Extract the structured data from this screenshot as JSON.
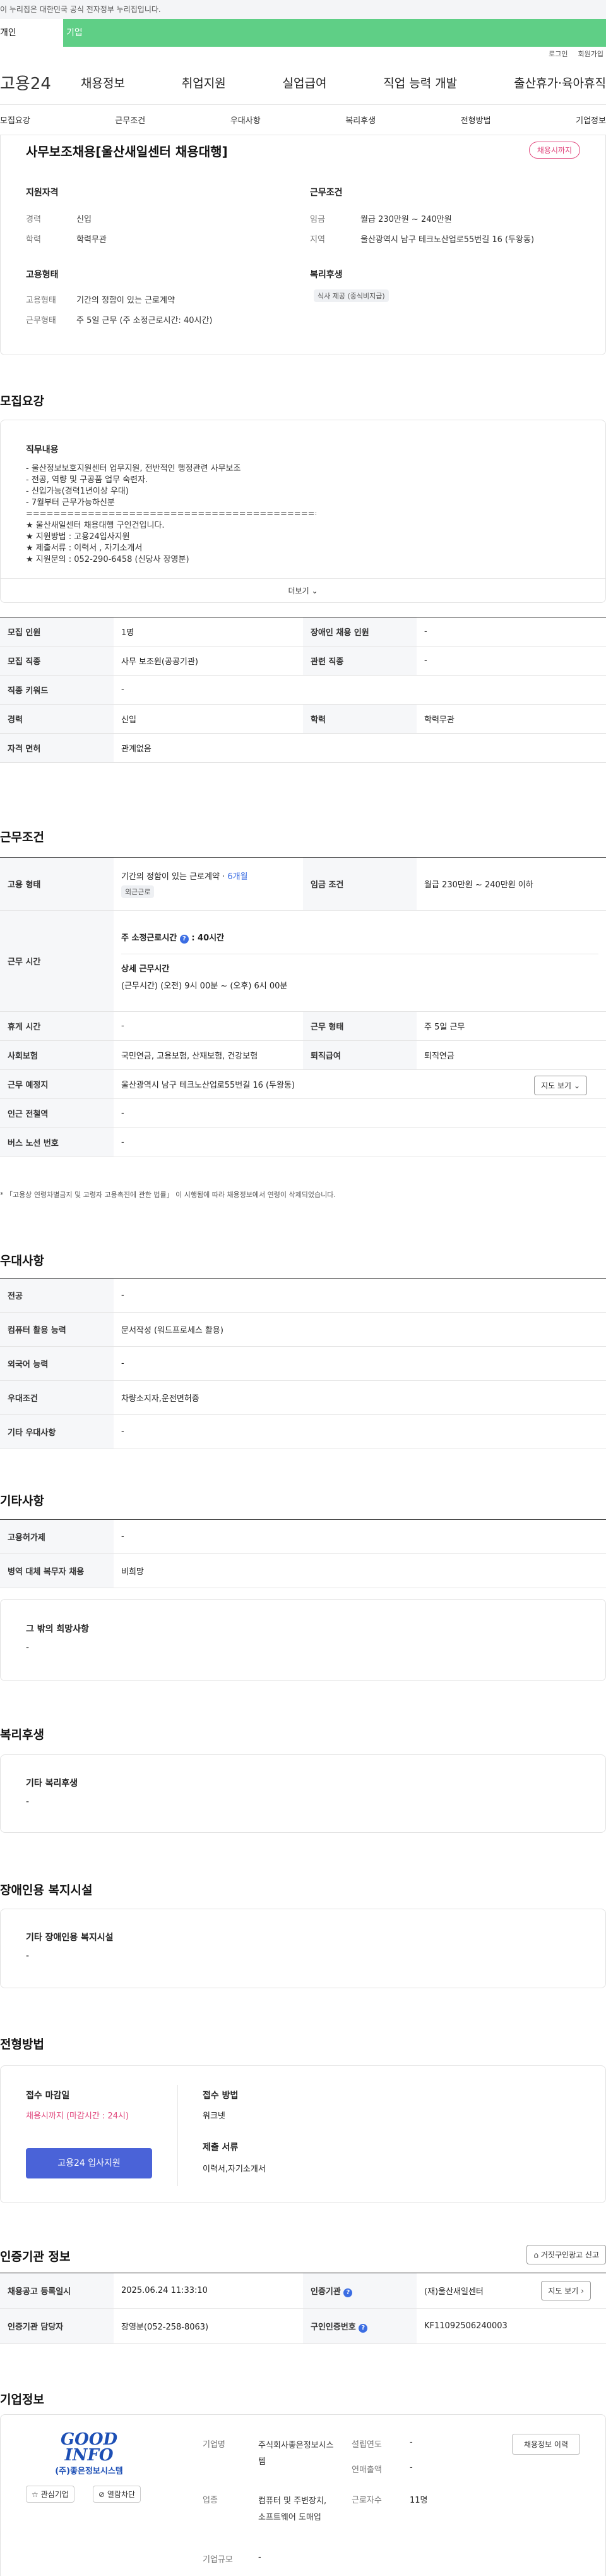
{
  "gov_banner": "이 누리집은 대한민국 공식 전자정부 누리집입니다.",
  "topbar": {
    "left": "개인",
    "right": "기업"
  },
  "util": {
    "login": "로그인",
    "join": "회원가입"
  },
  "logo": "고용24",
  "gnb": [
    "채용정보",
    "취업지원",
    "실업급여",
    "직업 능력 개발",
    "출산휴가·육아휴직"
  ],
  "subnav": [
    "모집요강",
    "근무조건",
    "우대사항",
    "복리후생",
    "전형방법",
    "기업정보"
  ],
  "summary": {
    "title": "사무보조채용[울산새일센터 채용대행]",
    "status_badge": "채용시까지",
    "qualification_title": "지원자격",
    "career_label": "경력",
    "career_value": "신입",
    "edu_label": "학력",
    "edu_value": "학력무관",
    "employ_title": "고용형태",
    "employ_type_label": "고용형태",
    "employ_type_value": "기간의 정함이 있는 근로계약",
    "work_type_label": "근무형태",
    "work_type_value": "주 5일 근무 (주 소정근로시간: 40시간)",
    "condition_title": "근무조건",
    "wage_label": "임금",
    "wage_value": "월급 230만원 ~ 240만원",
    "region_label": "지역",
    "region_value": "울산광역시 남구 테크노산업로55번길 16 (두왕동)",
    "welfare_title": "복리후생",
    "welfare_tag": "식사 제공 (중식비지급)"
  },
  "recruit": {
    "heading": "모집요강",
    "duty_title": "직무내용",
    "duty_lines": [
      "- 울산정보보호지원센터  업무지원, 전반적인 행정관련 사무보조",
      "- 전공, 역량 및 구공품 업무 숙련자.",
      "- 신입가능(경력1년이상 우대)",
      "- 7월부터 근무가능하신분",
      "============================================",
      "★ 울산새일센터 채용대행 구인건입니다.",
      "★ 지원방법 : 고용24입사지원",
      "★ 제출서류 : 이력서 , 자기소개서",
      "★ 지원문의 : 052-290-6458 (신당사 장영분)"
    ],
    "more_label": "더보기",
    "rows": [
      [
        {
          "k": "모집 인원",
          "v": "1명"
        },
        {
          "k": "장애인 채용 인원",
          "v": "-"
        }
      ],
      [
        {
          "k": "모집 직종",
          "v": "사무 보조원(공공기관)"
        },
        {
          "k": "관련 직종",
          "v": "-"
        }
      ],
      [
        {
          "k": "직종 키워드",
          "v": "-"
        }
      ],
      [
        {
          "k": "경력",
          "v": "신입"
        },
        {
          "k": "학력",
          "v": "학력무관"
        }
      ],
      [
        {
          "k": "자격 면허",
          "v": "관계없음"
        }
      ]
    ]
  },
  "work": {
    "heading": "근무조건",
    "employ_type_k": "고용 형태",
    "employ_type_v": "기간의 정함이 있는 근로계약 · ",
    "employ_period": "6개월",
    "employ_badge": "외근근로",
    "wage_k": "임금 조건",
    "wage_v": "월급 230만원 ~ 240만원 이하",
    "hours_k": "근무 시간",
    "hours_main": "주 소정근로시간",
    "hours_value": ": 40시간",
    "hours_detail_title": "상세 근무시간",
    "hours_detail": "(근무시간) (오전) 9시 00분 ~ (오후) 6시 00분",
    "rest_k": "휴게 시간",
    "rest_v": "-",
    "worktype_k": "근무 형태",
    "worktype_v": "주 5일 근무",
    "insurance_k": "사회보험",
    "insurance_v": "국민연금, 고용보험, 산재보험, 건강보험",
    "retire_k": "퇴직급여",
    "retire_v": "퇴직연금",
    "place_k": "근무 예정지",
    "place_v": "울산광역시 남구 테크노산업로55번길 16 (두왕동)",
    "map_btn": "지도 보기",
    "subway_k": "인근 전철역",
    "subway_v": "-",
    "bus_k": "버스 노선 번호",
    "bus_v": "-",
    "note": "* 「고용상 연령차별금지 및 고령자 고용촉진에 관한 법률」 이 시행됨에 따라 채용정보에서 연령이 삭제되었습니다."
  },
  "prefer": {
    "heading": "우대사항",
    "rows": [
      {
        "k": "전공",
        "v": "-"
      },
      {
        "k": "컴퓨터 활용 능력",
        "v": "문서작성 (워드프로세스 활용)"
      },
      {
        "k": "외국어 능력",
        "v": "-"
      },
      {
        "k": "우대조건",
        "v": "차량소지자,운전면허증"
      },
      {
        "k": "기타 우대사항",
        "v": "-"
      }
    ]
  },
  "etc": {
    "heading": "기타사항",
    "rows": [
      {
        "k": "고용허가제",
        "v": "-"
      },
      {
        "k": "병역 대체 복무자 채용",
        "v": "비희망"
      }
    ],
    "box_title": "그 밖의 희망사항",
    "box_value": "-"
  },
  "welfare": {
    "heading": "복리후생",
    "box_title": "기타 복리후생",
    "box_value": "-"
  },
  "disabled": {
    "heading": "장애인용 복지시설",
    "box_title": "기타 장애인용 복지시설",
    "box_value": "-"
  },
  "process": {
    "heading": "전형방법",
    "deadline_title": "접수 마감일",
    "deadline_value": "채용시까지 (마감시간 : 24시)",
    "apply_btn": "고용24 입사지원",
    "method_title": "접수 방법",
    "method_value": "워크넷",
    "docs_title": "제출 서류",
    "docs_value": "이력서,자기소개서"
  },
  "cert": {
    "heading": "인증기관 정보",
    "report_btn": "거짓구인광고 신고",
    "reg_k": "채용공고 등록일시",
    "reg_v": "2025.06.24 11:33:10",
    "org_k": "인증기관",
    "org_v": "(재)울산새일센터",
    "map_btn": "지도 보기",
    "manager_k": "인증기관 담당자",
    "manager_v": "장영분(052-258-8063)",
    "authno_k": "구인인증번호",
    "authno_v": "KF11092506240003"
  },
  "company": {
    "heading": "기업정보",
    "logo_top": "GOOD",
    "logo_bottom": "INFO",
    "logo_name": "(주)좋은정보시스템",
    "interest_btn": "관심기업",
    "block_btn": "열람차단",
    "name_k": "기업명",
    "name_v": "주식회사좋은정보시스템",
    "year_k": "설립연도",
    "year_v": "-",
    "sales_k": "연매출액",
    "sales_v": "-",
    "industry_k": "업종",
    "industry_v": "컴퓨터 및 주변장치, 소프트웨어 도매업",
    "staff_k": "근로자수",
    "staff_v": "11명",
    "size_k": "기업규모",
    "size_v": "-",
    "history_btn": "채용정보 이력"
  }
}
